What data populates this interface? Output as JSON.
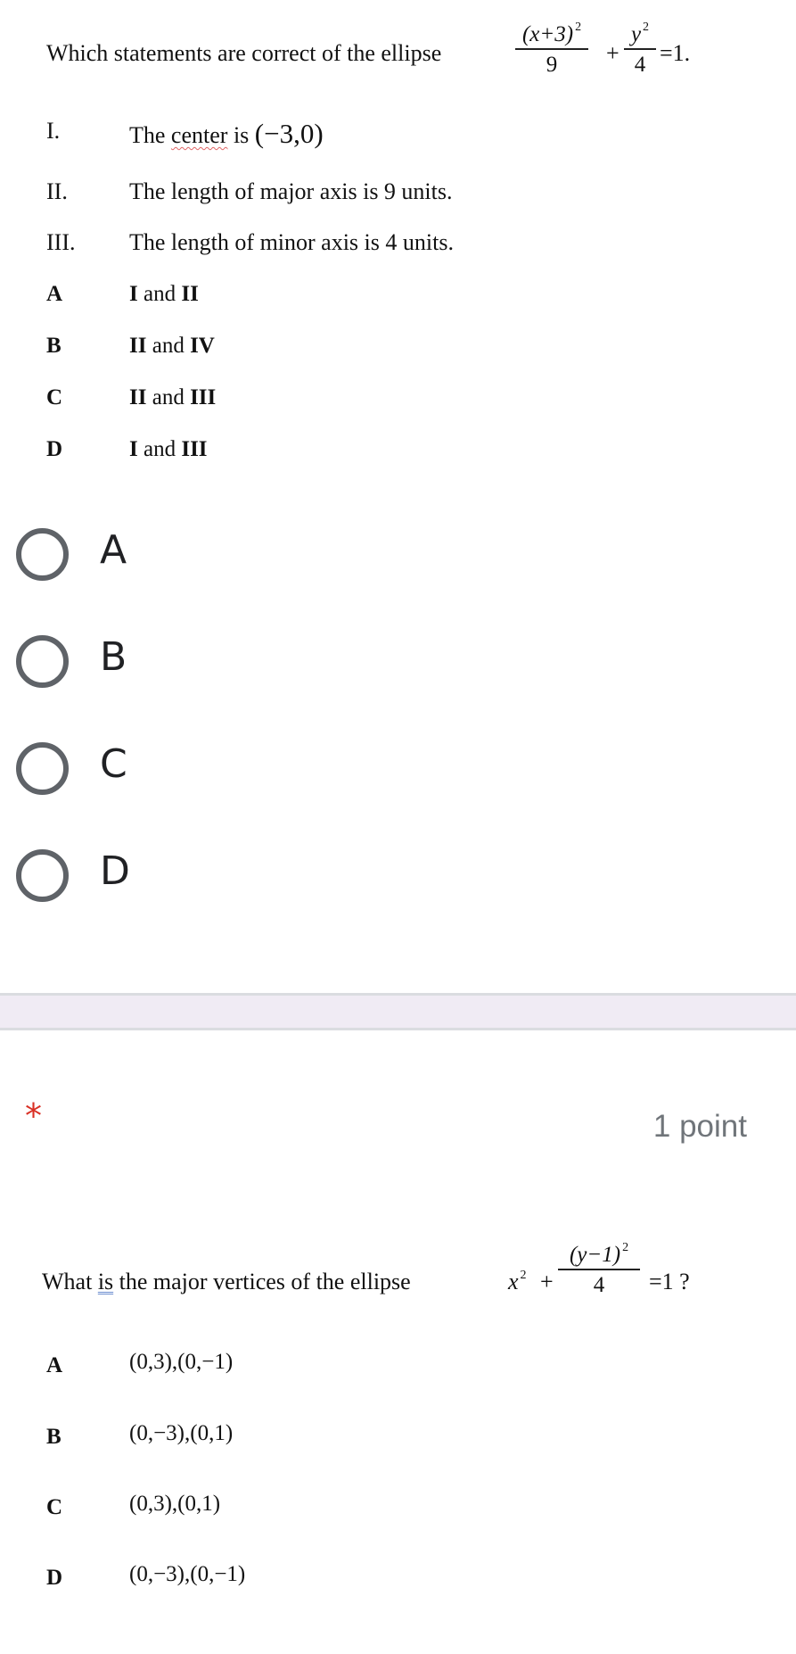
{
  "question1": {
    "prompt": "Which statements are correct of the ellipse",
    "equation": {
      "frac1_num": "(x+3)",
      "frac1_exp": "2",
      "frac1_den": "9",
      "plus": "+",
      "frac2_num": "y",
      "frac2_exp": "2",
      "frac2_den": "4",
      "rhs": "=1."
    },
    "statements": [
      {
        "num": "I.",
        "text": "The",
        "flagged_word": "center",
        "text_after": "is",
        "math": "(−3,0)"
      },
      {
        "num": "II.",
        "text": "The length of major axis is 9 units."
      },
      {
        "num": "III.",
        "text": "The length of minor axis is 4 units."
      }
    ],
    "options": [
      {
        "letter": "A",
        "parts": [
          {
            "t": "I",
            "b": true
          },
          {
            "t": " and ",
            "b": false
          },
          {
            "t": "II",
            "b": true
          }
        ]
      },
      {
        "letter": "B",
        "parts": [
          {
            "t": "II",
            "b": true
          },
          {
            "t": " and ",
            "b": false
          },
          {
            "t": "IV",
            "b": true
          }
        ]
      },
      {
        "letter": "C",
        "parts": [
          {
            "t": "II",
            "b": true
          },
          {
            "t": " and ",
            "b": false
          },
          {
            "t": "III",
            "b": true
          }
        ]
      },
      {
        "letter": "D",
        "parts": [
          {
            "t": "I",
            "b": true
          },
          {
            "t": " and ",
            "b": false
          },
          {
            "t": "III",
            "b": true
          }
        ]
      }
    ],
    "choices": [
      {
        "label": "A",
        "selected": false
      },
      {
        "label": "B",
        "selected": false
      },
      {
        "label": "C",
        "selected": false
      },
      {
        "label": "D",
        "selected": false
      }
    ]
  },
  "question2": {
    "required_mark": "*",
    "points": "1 point",
    "prompt_before": "What",
    "prompt_flagged": "is",
    "prompt_after": "the major vertices of the ellipse",
    "equation": {
      "term1": "x",
      "term1_exp": "2",
      "plus": "+",
      "frac_num": "(y−1)",
      "frac_exp": "2",
      "frac_den": "4",
      "rhs": "=1 ?"
    },
    "options": [
      {
        "letter": "A",
        "value": "(0,3),(0,−1)"
      },
      {
        "letter": "B",
        "value": "(0,−3),(0,1)"
      },
      {
        "letter": "C",
        "value": "(0,3),(0,1)"
      },
      {
        "letter": "D",
        "value": "(0,−3),(0,−1)"
      }
    ]
  },
  "colors": {
    "radio_border": "#5f6368",
    "required": "#d93025",
    "points_text": "#70757a",
    "divider_fill": "#f0ebf4",
    "divider_border": "#dadce0"
  }
}
